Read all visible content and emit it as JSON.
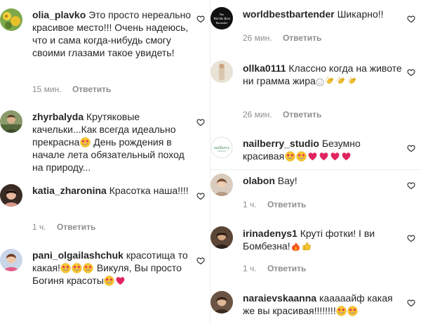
{
  "icons": {
    "like": "heart-outline-icon",
    "star_eyes": "star-struck-emoji",
    "red_heart": "red-heart-emoji",
    "clap": "clapping-hands-emoji",
    "smile": "smiling-face-emoji",
    "fire": "fire-emoji",
    "thumbs": "thumbs-up-emoji"
  },
  "colors": {
    "username": "#262626",
    "meta": "#8e8e8e",
    "heart": "#262626",
    "emoji_yellow": "#f7c531",
    "emoji_red": "#e0245e"
  },
  "left": [
    {
      "user": "olia_plavko",
      "segments": [
        "Это просто нереально красивое место!!! Очень надеюсь, что и сама когда-нибудь смогу своими глазами такое увидеть!"
      ],
      "time": "15 мин.",
      "reply": "Ответить"
    },
    {
      "user": "zhyrbalyda",
      "segments": [
        "Крутяковые качельки...Как всегда идеально прекрасна",
        "День рождения в начале лета обязательный поход на природу..."
      ],
      "time": "",
      "reply": ""
    },
    {
      "user": "katia_zharonina",
      "segments": [
        "Красотка наша!!!!"
      ],
      "time": "1 ч.",
      "reply": "Ответить"
    },
    {
      "user": "pani_olgailashchuk",
      "segments": [
        "красотища то какая!",
        "Викуля, Вы просто Богиня красоты"
      ],
      "time": "",
      "reply": ""
    }
  ],
  "right": [
    {
      "user": "worldbestbartender",
      "segments": [
        "Шикарно!!"
      ],
      "time": "26 мин.",
      "reply": "Ответить",
      "avatar_text": "The Worlds Best Bartender"
    },
    {
      "user": "ollka0111",
      "segments": [
        "Классно когда на животе ни грамма жира"
      ],
      "time": "26 мин.",
      "reply": "Ответить"
    },
    {
      "user": "nailberry_studio",
      "segments": [
        "Безумно красивая"
      ],
      "time": "",
      "reply": "",
      "avatar_text": "nailberry"
    },
    {
      "user": "olabon",
      "segments": [
        "Вау!"
      ],
      "time": "1 ч.",
      "reply": "Ответить"
    },
    {
      "user": "irinadenys1",
      "segments": [
        "Круті фотки! І ви Бомбезна!"
      ],
      "time": "1 ч.",
      "reply": "Ответить"
    },
    {
      "user": "naraievskaanna",
      "segments": [
        "кааааайф какая же вы красивая!!!!!!!!"
      ],
      "time": "",
      "reply": ""
    }
  ]
}
